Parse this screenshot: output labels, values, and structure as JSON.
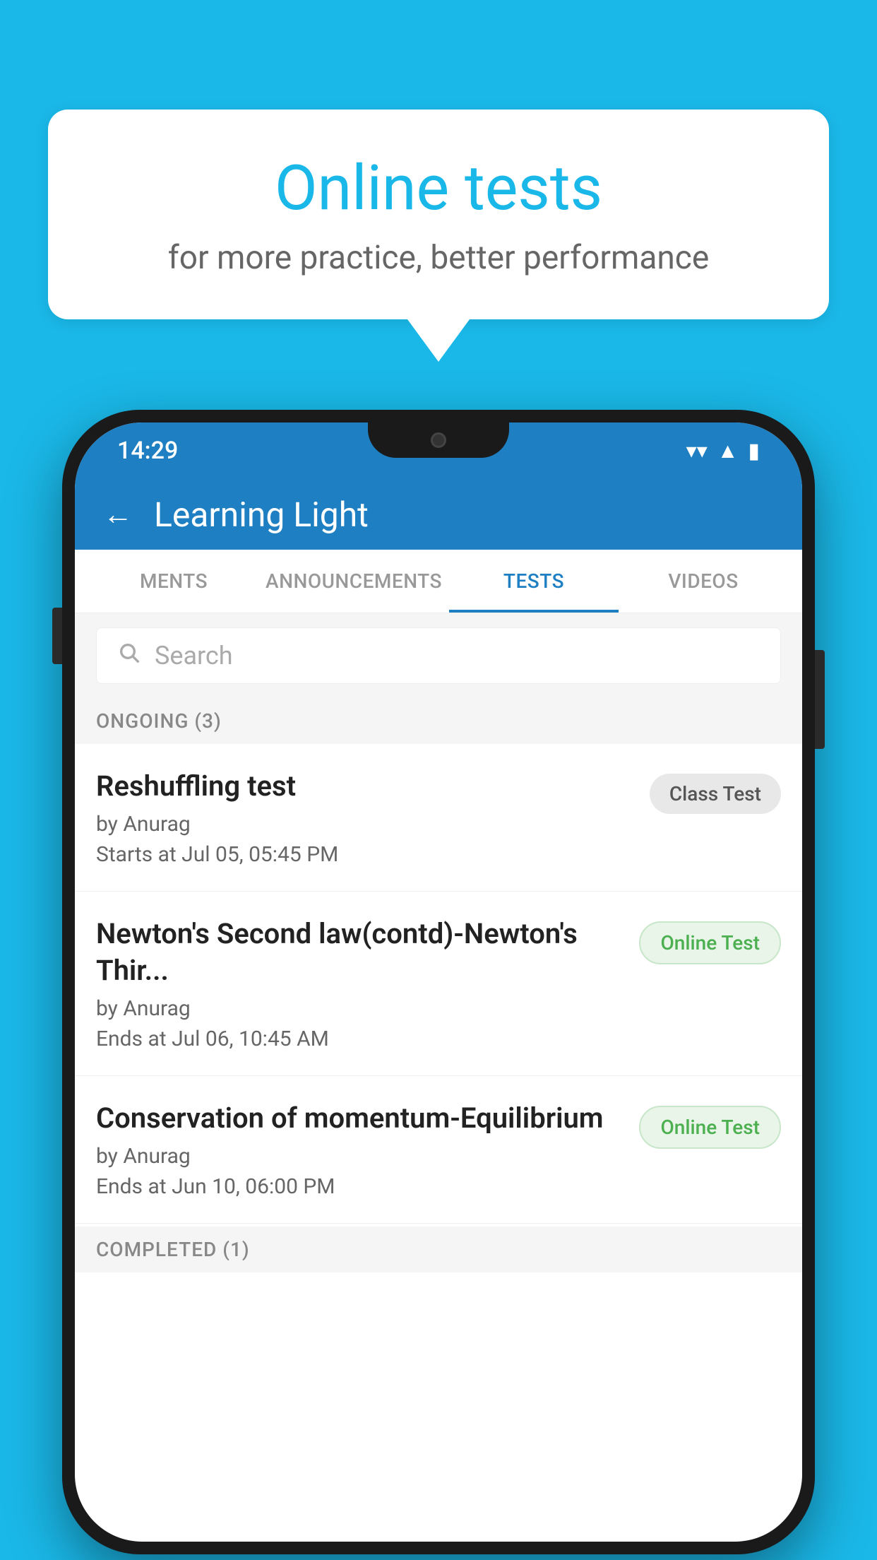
{
  "background_color": "#1ab8e8",
  "speech_bubble": {
    "title": "Online tests",
    "subtitle": "for more practice, better performance"
  },
  "phone": {
    "status_bar": {
      "time": "14:29",
      "wifi": "▼",
      "signal": "▲",
      "battery": "▮"
    },
    "app_header": {
      "back_label": "←",
      "title": "Learning Light"
    },
    "tabs": [
      {
        "label": "MENTS",
        "active": false
      },
      {
        "label": "ANNOUNCEMENTS",
        "active": false
      },
      {
        "label": "TESTS",
        "active": true
      },
      {
        "label": "VIDEOS",
        "active": false
      }
    ],
    "search": {
      "placeholder": "Search"
    },
    "ongoing_section": {
      "label": "ONGOING (3)"
    },
    "tests": [
      {
        "name": "Reshuffling test",
        "author": "by Anurag",
        "time_label": "Starts at",
        "time": "Jul 05, 05:45 PM",
        "badge": "Class Test",
        "badge_type": "class"
      },
      {
        "name": "Newton's Second law(contd)-Newton's Thir...",
        "author": "by Anurag",
        "time_label": "Ends at",
        "time": "Jul 06, 10:45 AM",
        "badge": "Online Test",
        "badge_type": "online"
      },
      {
        "name": "Conservation of momentum-Equilibrium",
        "author": "by Anurag",
        "time_label": "Ends at",
        "time": "Jun 10, 06:00 PM",
        "badge": "Online Test",
        "badge_type": "online"
      }
    ],
    "completed_section": {
      "label": "COMPLETED (1)"
    }
  }
}
